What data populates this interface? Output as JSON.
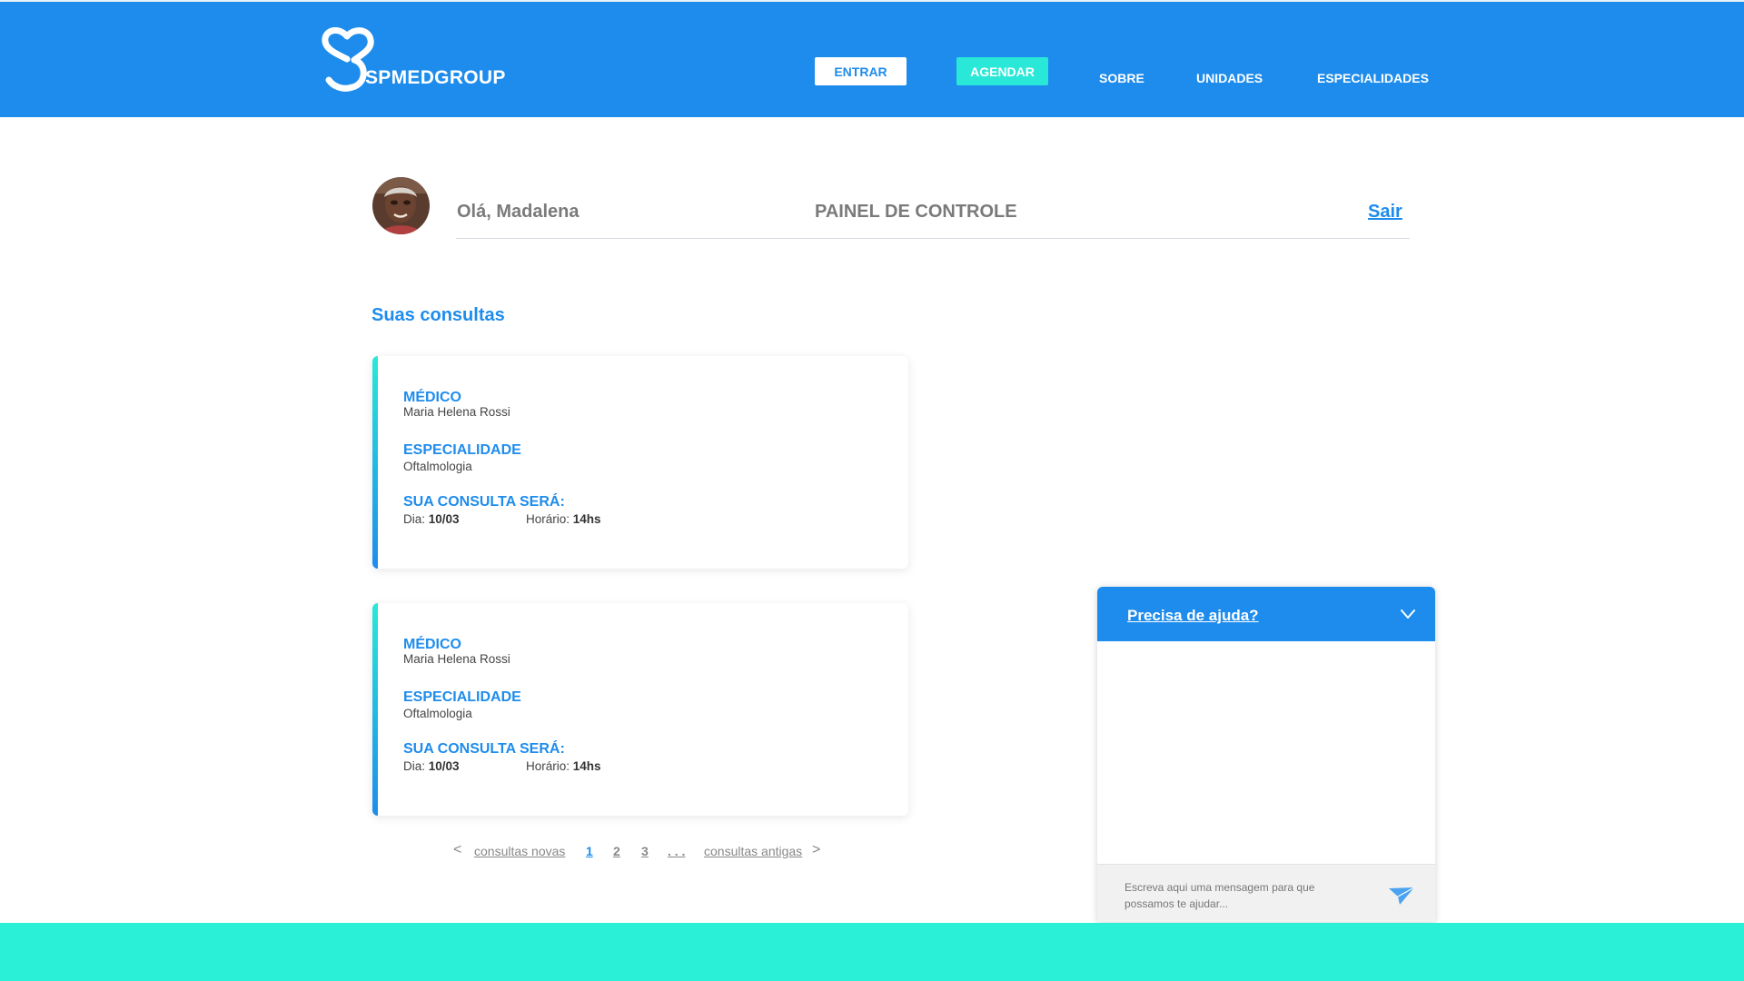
{
  "header": {
    "brand": "SPMEDGROUP",
    "nav": {
      "entrar": "ENTRAR",
      "agendar": "AGENDAR",
      "sobre": "SOBRE",
      "unidades": "UNIDADES",
      "especialidades": "ESPECIALIDADES"
    }
  },
  "user": {
    "greeting": "Olá, Madalena",
    "panel_title": "PAINEL DE CONTROLE",
    "logout": "Sair"
  },
  "section_title": "Suas consultas",
  "consultas": [
    {
      "medico_label": "MÉDICO",
      "medico": "Maria Helena Rossi",
      "especialidade_label": "ESPECIALIDADE",
      "especialidade": "Oftalmologia",
      "quando_label": "SUA CONSULTA SERÁ:",
      "dia_label": "Dia:",
      "dia": "10/03",
      "horario_label": "Horário:",
      "horario": "14hs"
    },
    {
      "medico_label": "MÉDICO",
      "medico": "Maria Helena Rossi",
      "especialidade_label": "ESPECIALIDADE",
      "especialidade": "Oftalmologia",
      "quando_label": "SUA CONSULTA SERÁ:",
      "dia_label": "Dia:",
      "dia": "10/03",
      "horario_label": "Horário:",
      "horario": "14hs"
    }
  ],
  "pagination": {
    "prev_arrow": "<",
    "newer": "consultas novas",
    "pages": [
      "1",
      "2",
      "3"
    ],
    "ellipsis": ". . .",
    "older": "consultas antigas",
    "next_arrow": ">"
  },
  "chat": {
    "title": "Precisa de ajuda?",
    "placeholder": "Escreva aqui uma mensagem para que possamos te ajudar..."
  },
  "colors": {
    "primary": "#1e8cec",
    "accent": "#2ae8d8",
    "footer": "#2af0d8"
  },
  "icons": {
    "logo": "heart-s-logo-icon",
    "chat_toggle": "chevron-down-icon",
    "send": "paper-plane-icon"
  }
}
